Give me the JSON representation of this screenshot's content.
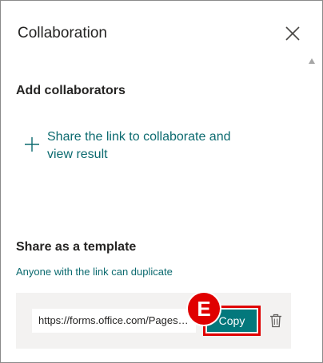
{
  "panel": {
    "title": "Collaboration"
  },
  "collaborators": {
    "heading": "Add collaborators",
    "share_link_label": "Share the link to collaborate and view result"
  },
  "template": {
    "heading": "Share as a template",
    "description": "Anyone with the link can duplicate",
    "url_value": "https://forms.office.com/Pages/ShareFormPage.aspx",
    "copy_label": "Copy"
  },
  "annotation": {
    "step_label": "E"
  },
  "colors": {
    "accent": "#03787c",
    "link_text": "#0b6a6f",
    "highlight": "#e00000",
    "box_background": "#f3f2f1"
  },
  "icons": {
    "close": "close-icon",
    "plus": "plus-icon",
    "trash": "trash-icon",
    "scroll_up": "scroll-up-arrow-icon"
  }
}
